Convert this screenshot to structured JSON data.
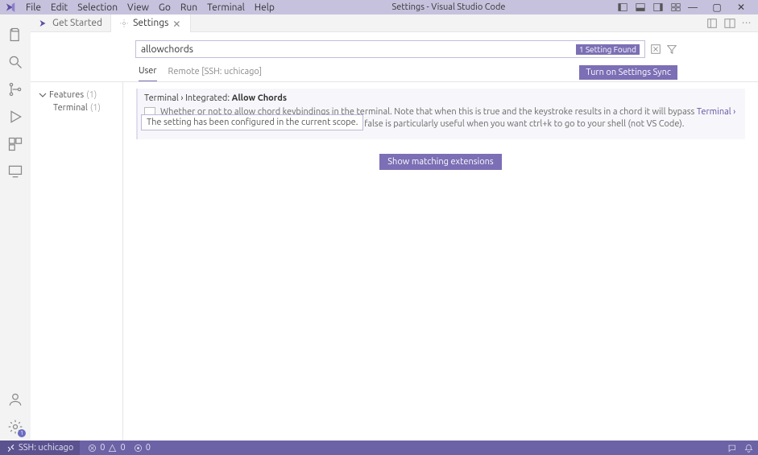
{
  "window": {
    "title": "Settings - Visual Studio Code"
  },
  "menu": {
    "items": [
      "File",
      "Edit",
      "Selection",
      "View",
      "Go",
      "Run",
      "Terminal",
      "Help"
    ]
  },
  "tabs": {
    "getStarted": "Get Started",
    "settings": "Settings"
  },
  "settings": {
    "search_value": "allowchords",
    "found_badge": "1 Setting Found",
    "scope_user": "User",
    "scope_remote": "Remote [SSH: uchicago]",
    "sync_button": "Turn on Settings Sync",
    "outline": {
      "features": "Features",
      "features_count": "(1)",
      "terminal": "Terminal",
      "terminal_count": "(1)"
    },
    "item": {
      "breadcrumb_prefix": "Terminal › Integrated: ",
      "title_bold": "Allow Chords",
      "desc_1": "Whether or not to allow chord keybindings in the terminal. Note that when this is true and the keystroke results in a chord it will bypass ",
      "link_text": "Terminal › Integrated: Commands To Skip Shell",
      "desc_2": ", setting this to false is particularly useful when you want ctrl+k to go to your shell (not VS Code).",
      "tooltip": "The setting has been configured in the current scope.",
      "match_ext": "Show matching extensions"
    }
  },
  "status": {
    "remote": "SSH: uchicago",
    "errors": "0",
    "warnings": "0",
    "ports": "0",
    "badge": "1"
  }
}
